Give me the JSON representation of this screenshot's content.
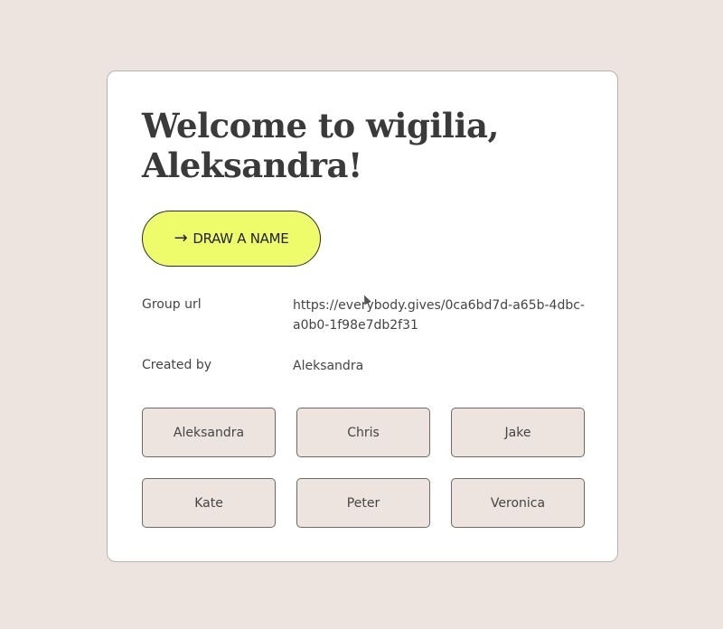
{
  "welcome": {
    "line1": "Welcome to wigilia,",
    "line2": "Aleksandra!"
  },
  "draw_button": {
    "label": "DRAW A NAME",
    "icon": "arrow-right-icon"
  },
  "info": {
    "group_url_label": "Group url",
    "group_url_value": "https://everybody.gives/0ca6bd7d-a65b-4dbc-a0b0-1f98e7db2f31",
    "created_by_label": "Created by",
    "created_by_value": "Aleksandra"
  },
  "members": [
    "Aleksandra",
    "Chris",
    "Jake",
    "Kate",
    "Peter",
    "Veronica"
  ],
  "colors": {
    "background": "#ede4df",
    "card": "#ffffff",
    "accent": "#eefb6b",
    "tile": "#ede4df"
  }
}
